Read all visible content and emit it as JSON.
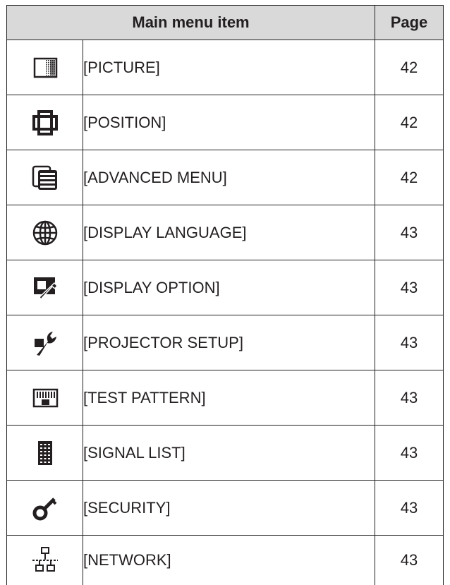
{
  "table": {
    "header": {
      "item": "Main menu item",
      "page": "Page"
    },
    "rows": [
      {
        "icon": "picture-icon",
        "label": "[PICTURE]",
        "page": "42"
      },
      {
        "icon": "position-icon",
        "label": "[POSITION]",
        "page": "42"
      },
      {
        "icon": "advanced-menu-icon",
        "label": "[ADVANCED MENU]",
        "page": "42"
      },
      {
        "icon": "globe-icon",
        "label": "[DISPLAY LANGUAGE]",
        "page": "43"
      },
      {
        "icon": "display-option-icon",
        "label": "[DISPLAY OPTION]",
        "page": "43"
      },
      {
        "icon": "wrench-icon",
        "label": "[PROJECTOR SETUP]",
        "page": "43"
      },
      {
        "icon": "test-pattern-icon",
        "label": "[TEST PATTERN]",
        "page": "43"
      },
      {
        "icon": "signal-list-icon",
        "label": "[SIGNAL LIST]",
        "page": "43"
      },
      {
        "icon": "key-icon",
        "label": "[SECURITY]",
        "page": "43"
      },
      {
        "icon": "network-icon",
        "label": "[NETWORK]",
        "page": "43"
      }
    ]
  }
}
